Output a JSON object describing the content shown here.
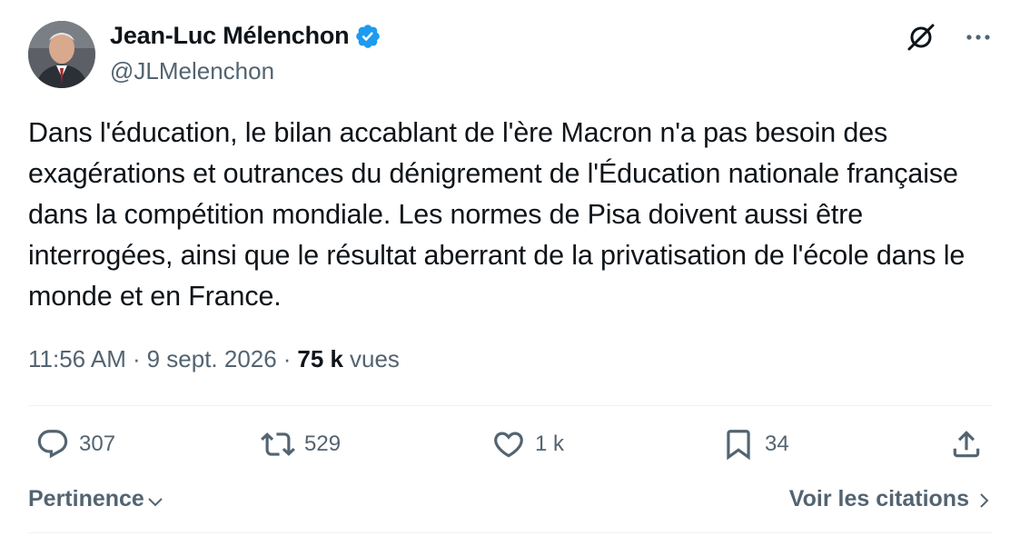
{
  "author": {
    "name": "Jean-Luc Mélenchon",
    "handle": "@JLMelenchon",
    "verified_color": "#1d9bf0"
  },
  "tweet": {
    "text": "Dans l'éducation, le bilan accablant de l'ère Macron n'a pas besoin des exagérations et outrances du dénigrement de l'Éducation nationale française dans la compétition mondiale. Les normes de Pisa doivent aussi être interrogées, ainsi que le résultat aberrant de la privatisation de l'école dans le monde et en France."
  },
  "meta": {
    "time": "11:56 AM",
    "separator": "·",
    "date": "9 sept. 2026",
    "views_count": "75 k",
    "views_label": "vues"
  },
  "actions": {
    "replies": "307",
    "reposts": "529",
    "likes": "1 k",
    "bookmarks": "34"
  },
  "footer": {
    "sort_label": "Pertinence",
    "quotes_label": "Voir les citations"
  },
  "icons": {
    "top": [
      "grok-icon",
      "more-icon"
    ],
    "actions": [
      "reply-icon",
      "repost-icon",
      "like-icon",
      "bookmark-icon",
      "share-icon"
    ]
  }
}
